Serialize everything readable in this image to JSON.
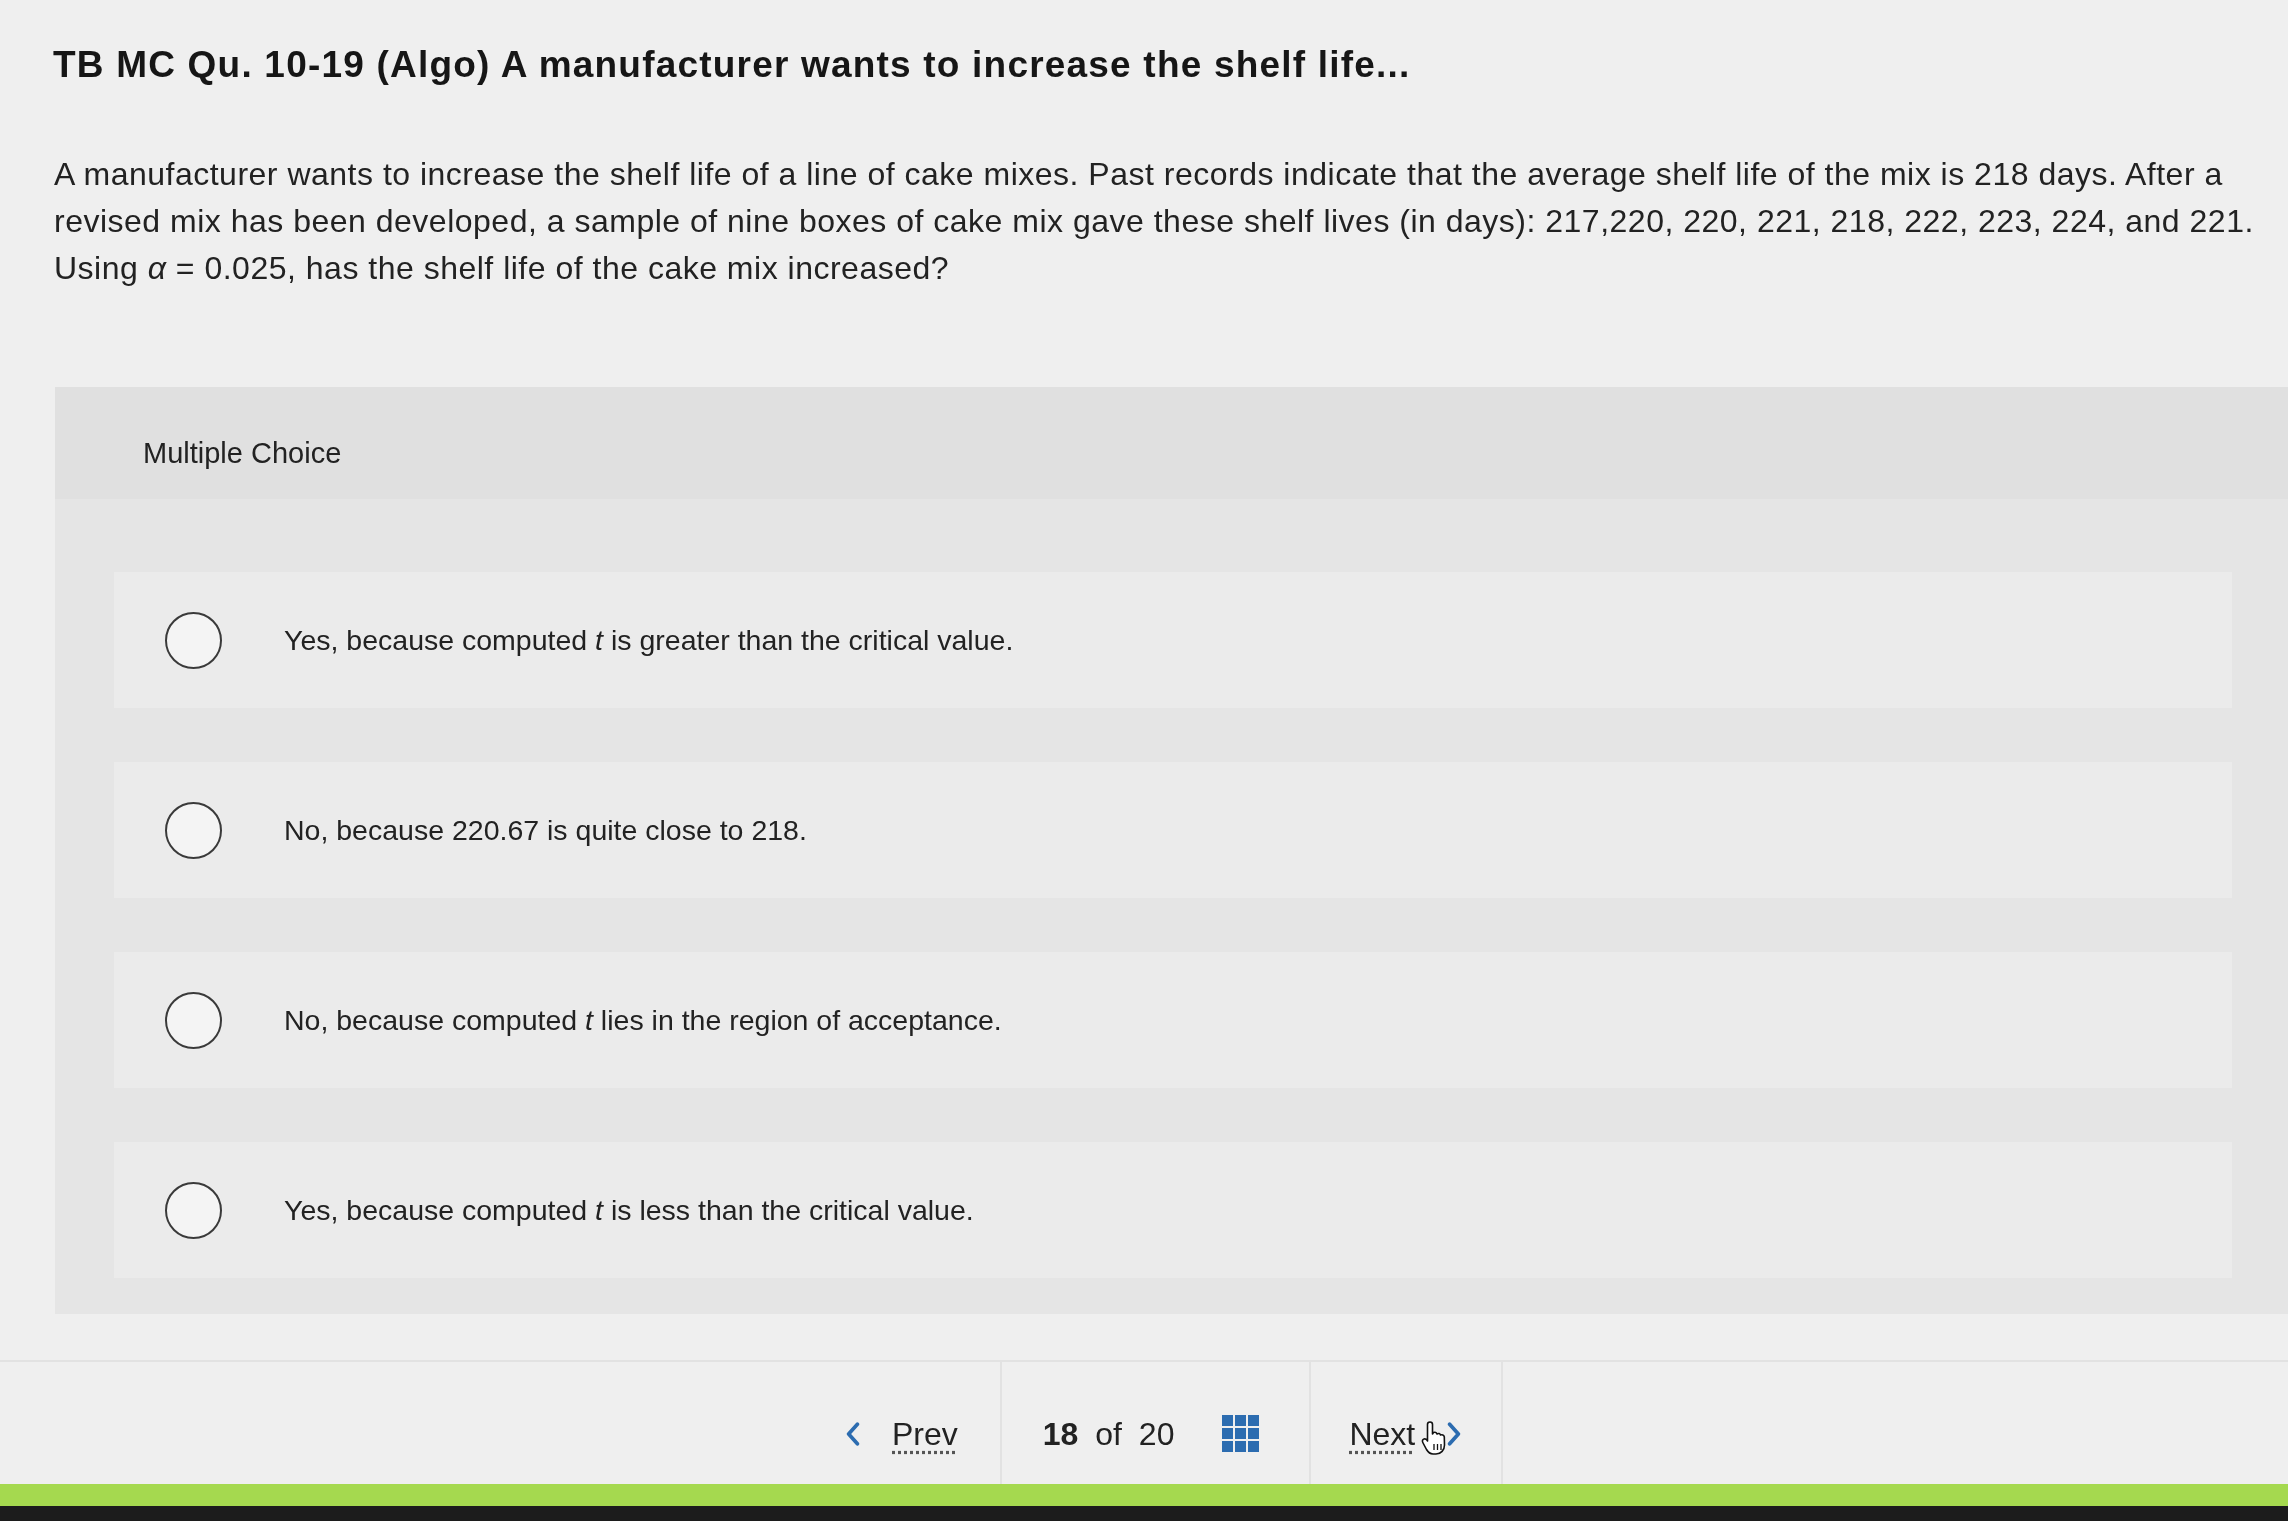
{
  "question": {
    "title": "TB MC Qu. 10-19 (Algo) A manufacturer wants to increase the shelf life...",
    "text": "A manufacturer wants to increase the shelf life of a line of cake mixes. Past records indicate that the average shelf life of the mix is 218 days. After a revised mix has been developed, a sample of nine boxes of cake mix gave these shelf lives (in days): 217,220, 220, 221, 218, 222, 223, 224, and 221. Using *α* = 0.025, has the shelf life of the cake mix increased?"
  },
  "multiple_choice": {
    "heading": "Multiple Choice",
    "options": [
      {
        "text": "Yes, because computed *t* is greater than the critical value.",
        "selected": false
      },
      {
        "text": "No, because 220.67 is quite close to 218.",
        "selected": false
      },
      {
        "text": "No, because computed *t* lies in the region of acceptance.",
        "selected": false
      },
      {
        "text": "Yes, because computed *t* is less than the critical value.",
        "selected": false
      }
    ]
  },
  "navigation": {
    "prev": "Prev",
    "position": "**18** of 20",
    "next": "Next"
  }
}
